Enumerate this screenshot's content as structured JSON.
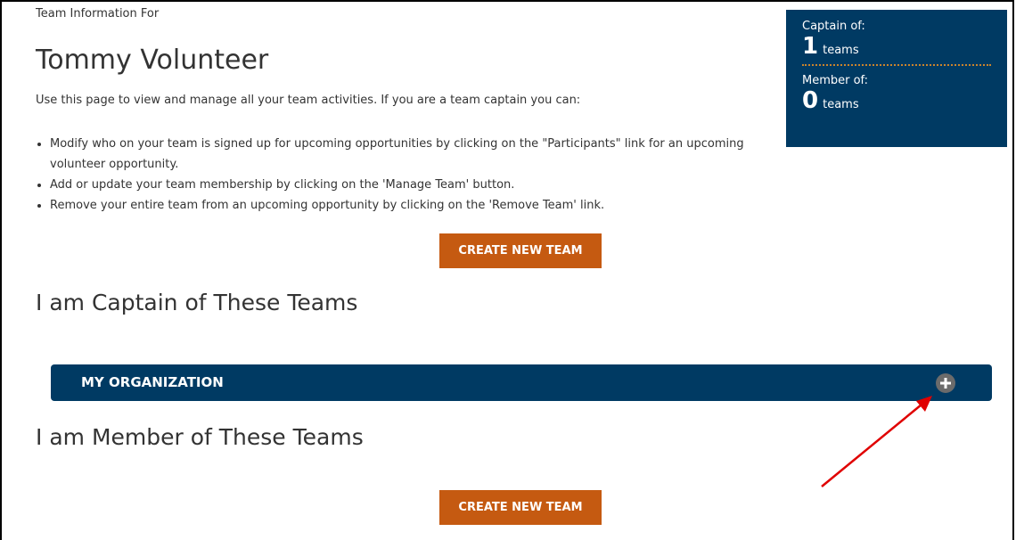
{
  "header": {
    "subtitle": "Team Information For",
    "name": "Tommy Volunteer",
    "intro": "Use this page to view and manage all your team activities. If you are a team captain you can:"
  },
  "bullets": [
    "Modify who on your team is signed up for upcoming opportunities by clicking on the \"Participants\" link for an upcoming volunteer opportunity.",
    "Add or update your team membership by clicking on the 'Manage Team' button.",
    "Remove your entire team from an upcoming opportunity by clicking on the 'Remove Team' link."
  ],
  "stats": {
    "captain_label": "Captain of:",
    "captain_count": "1",
    "captain_unit": "teams",
    "member_label": "Member of:",
    "member_count": "0",
    "member_unit": "teams"
  },
  "buttons": {
    "create_team_top": "CREATE NEW TEAM",
    "create_team_bottom": "CREATE NEW TEAM"
  },
  "sections": {
    "captain_heading": "I am Captain of These Teams",
    "member_heading": "I am Member of These Teams"
  },
  "organization": {
    "label": "MY ORGANIZATION",
    "expand_icon": "plus-circle-icon"
  },
  "colors": {
    "navy": "#003a63",
    "orange": "#c55a11",
    "annotation_red": "#e00000"
  }
}
